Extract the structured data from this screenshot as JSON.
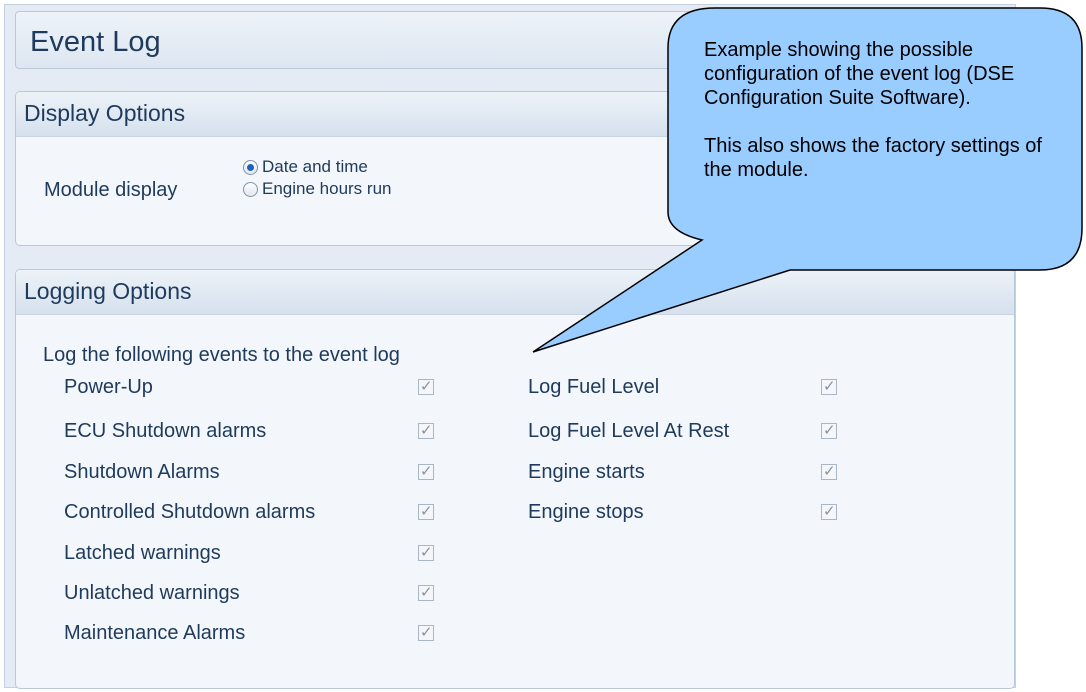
{
  "title": "Event Log",
  "display_options": {
    "heading": "Display Options",
    "module_display_label": "Module display",
    "radios": [
      {
        "label": "Date and time",
        "selected": true
      },
      {
        "label": "Engine hours run",
        "selected": false
      }
    ]
  },
  "logging_options": {
    "heading": "Logging Options",
    "intro": "Log the following events to the event log",
    "left_items": [
      {
        "label": "Power-Up",
        "checked": true
      },
      {
        "label": "ECU Shutdown alarms",
        "checked": true
      },
      {
        "label": "Shutdown Alarms",
        "checked": true
      },
      {
        "label": "Controlled Shutdown alarms",
        "checked": true
      },
      {
        "label": "Latched warnings",
        "checked": true
      },
      {
        "label": "Unlatched warnings",
        "checked": true
      },
      {
        "label": "Maintenance Alarms",
        "checked": true
      }
    ],
    "right_items": [
      {
        "label": "Log Fuel Level",
        "checked": true
      },
      {
        "label": "Log Fuel Level At Rest",
        "checked": true
      },
      {
        "label": "Engine starts",
        "checked": true
      },
      {
        "label": "Engine stops",
        "checked": true
      }
    ]
  },
  "callout": {
    "text": "Example showing the possible configuration of the event log (DSE Configuration Suite Software).\n\nThis also shows the factory settings of the module.",
    "fill_color": "#99ccff"
  }
}
